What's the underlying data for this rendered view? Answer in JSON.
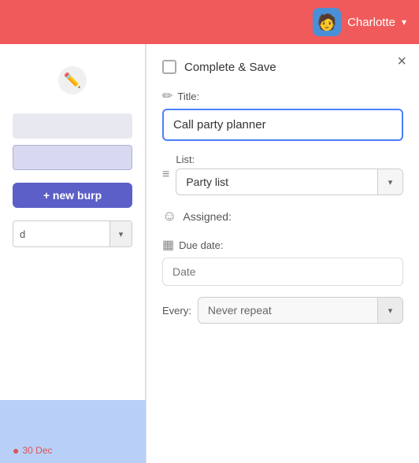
{
  "header": {
    "user_name": "Charlotte",
    "chevron": "▾",
    "avatar_emoji": "🧑"
  },
  "left_panel": {
    "edit_icon": "✏️",
    "new_burp_btn": "+ new burp",
    "dropdown_placeholder": "d",
    "bottom_date": "30 Dec"
  },
  "modal": {
    "close_label": "×",
    "complete_save_label": "Complete & Save",
    "title_label": "Title:",
    "title_value": "Call party planner",
    "title_icon": "✏️",
    "list_label": "List:",
    "list_icon": "≡",
    "list_value": "Party list",
    "list_caret": "▾",
    "assigned_label": "Assigned:",
    "assigned_icon": "🙂",
    "due_date_label": "Due date:",
    "due_date_placeholder": "Date",
    "calendar_icon": "📅",
    "every_label": "Every:",
    "every_value": "Never repeat",
    "every_caret": "▾"
  },
  "icons": {
    "close": "×",
    "caret": "▾",
    "pencil": "✏",
    "list_lines": "≡",
    "smiley": "☺",
    "calendar": "▦"
  }
}
